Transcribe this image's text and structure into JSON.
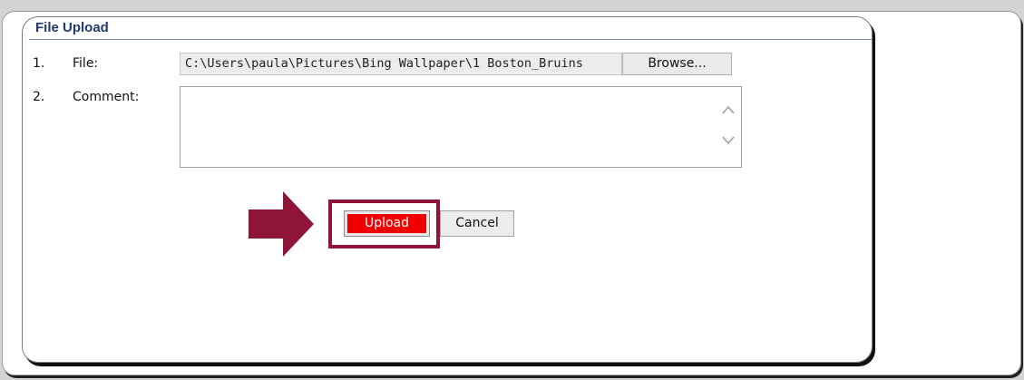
{
  "panel": {
    "title": "File Upload"
  },
  "form": {
    "rows": [
      {
        "num": "1.",
        "label": "File:"
      },
      {
        "num": "2.",
        "label": "Comment:"
      }
    ],
    "file_value": "C:\\Users\\paula\\Pictures\\Bing Wallpaper\\1 Boston_Bruins",
    "browse_label": "Browse...",
    "comment_value": ""
  },
  "actions": {
    "upload_label": "Upload",
    "cancel_label": "Cancel"
  },
  "colors": {
    "upload_fill": "#f00000",
    "highlight": "#8e1538",
    "title": "#1f3a6e"
  },
  "icons": [
    "arrow-right-icon",
    "scroll-up-icon",
    "scroll-down-icon"
  ]
}
